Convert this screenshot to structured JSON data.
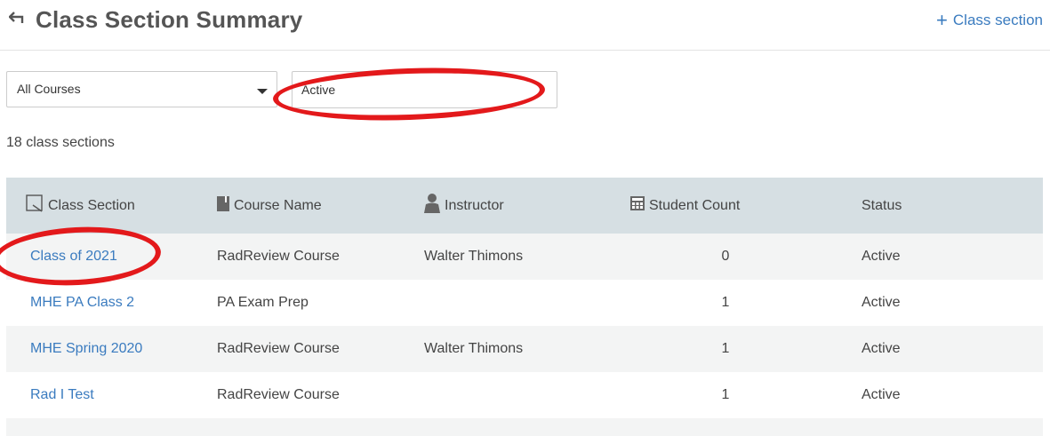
{
  "header": {
    "title": "Class Section Summary",
    "add_label": "Class section",
    "back_icon": "back-arrow-icon",
    "add_icon": "plus-icon"
  },
  "filters": {
    "course_select": {
      "value": "All Courses"
    },
    "status_input": {
      "value": "Active"
    }
  },
  "summary": {
    "count_text": "18 class sections"
  },
  "table": {
    "columns": [
      {
        "label": "Class Section",
        "icon": "checkbox-icon"
      },
      {
        "label": "Course Name",
        "icon": "book-icon"
      },
      {
        "label": "Instructor",
        "icon": "user-icon"
      },
      {
        "label": "Student Count",
        "icon": "calculator-icon"
      },
      {
        "label": "Status",
        "icon": ""
      }
    ],
    "rows": [
      {
        "section": "Class of 2021",
        "course": "RadReview Course",
        "instructor": "Walter Thimons",
        "students": "0",
        "status": "Active"
      },
      {
        "section": "MHE PA Class 2",
        "course": "PA Exam Prep",
        "instructor": "",
        "students": "1",
        "status": "Active"
      },
      {
        "section": "MHE Spring 2020",
        "course": "RadReview Course",
        "instructor": "Walter Thimons",
        "students": "1",
        "status": "Active"
      },
      {
        "section": "Rad I Test",
        "course": "RadReview Course",
        "instructor": "",
        "students": "1",
        "status": "Active"
      }
    ]
  },
  "colors": {
    "link": "#3a7bbf",
    "header_bg": "#d6dfe3",
    "annotation": "#e3191b"
  }
}
